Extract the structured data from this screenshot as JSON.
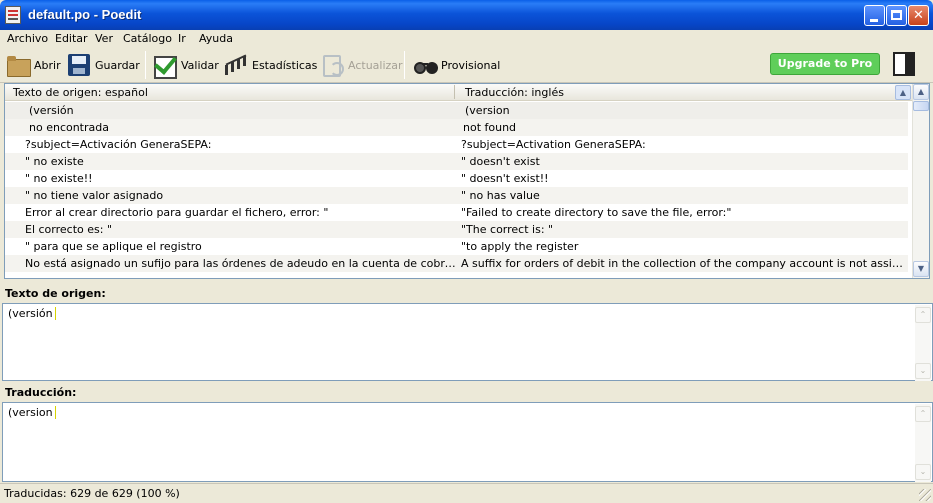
{
  "window": {
    "title": "default.po - Poedit",
    "min_glyph": "",
    "max_glyph": "",
    "close_glyph": "✕"
  },
  "menu": [
    "Archivo",
    "Editar",
    "Ver",
    "Catálogo",
    "Ir",
    "Ayuda"
  ],
  "toolbar": {
    "open": "Abrir",
    "save": "Guardar",
    "validate": "Validar",
    "stats": "Estadísticas",
    "update": "Actualizar",
    "fuzzy": "Provisional",
    "upgrade": "Upgrade to Pro"
  },
  "list": {
    "col_source": "Texto de origen: español",
    "col_translation": "Traducción: inglés",
    "rows": [
      {
        "source": "(versión",
        "translation": "(version"
      },
      {
        "source": "no encontrada",
        "translation": "not found"
      },
      {
        "source": "?subject=Activación GeneraSEPA:",
        "translation": "?subject=Activation GeneraSEPA:"
      },
      {
        "source": "\" no existe",
        "translation": "\" doesn't exist"
      },
      {
        "source": "\" no existe!!",
        "translation": "\" doesn't exist!!"
      },
      {
        "source": "\" no tiene valor asignado",
        "translation": "\" no has value"
      },
      {
        "source": "Error al crear directorio para guardar el fichero, error: \"",
        "translation": "\"Failed to create directory to save the file, error:\""
      },
      {
        "source": "El correcto es: \"",
        "translation": "\"The correct is: \""
      },
      {
        "source": "\" para que se aplique el registro",
        "translation": "\"to apply the register"
      },
      {
        "source": "No está asignado un sufijo para las órdenes de adeudo en la cuenta de cobro de la em...",
        "translation": "A suffix for orders of debit in the collection of the company account is not assigned!"
      }
    ]
  },
  "source_pane": {
    "label": "Texto de origen:",
    "text": "(versión"
  },
  "translation_pane": {
    "label": "Traducción:",
    "text": "(version"
  },
  "status": {
    "text": "Traducidas: 629 de 629 (100 %)"
  },
  "scroll": {
    "up": "▲",
    "down": "▼",
    "up_light": "⌃",
    "down_light": "⌄"
  }
}
